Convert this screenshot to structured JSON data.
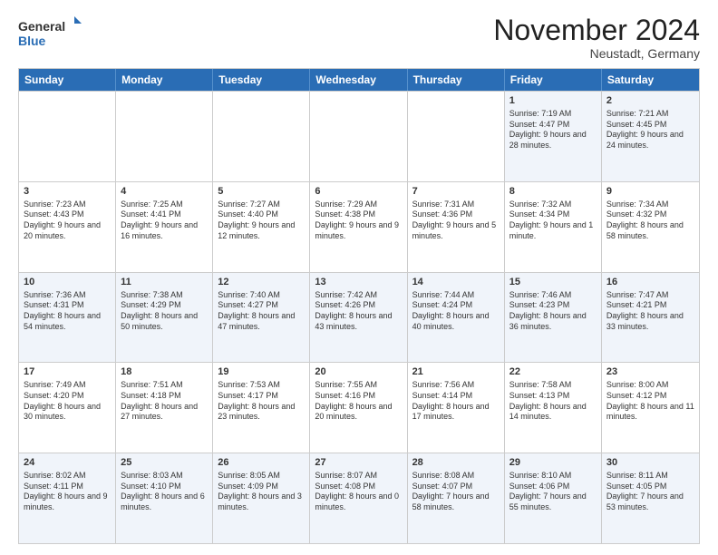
{
  "header": {
    "logo_general": "General",
    "logo_blue": "Blue",
    "month_title": "November 2024",
    "subtitle": "Neustadt, Germany"
  },
  "calendar": {
    "weekdays": [
      "Sunday",
      "Monday",
      "Tuesday",
      "Wednesday",
      "Thursday",
      "Friday",
      "Saturday"
    ],
    "rows": [
      [
        {
          "day": "",
          "info": ""
        },
        {
          "day": "",
          "info": ""
        },
        {
          "day": "",
          "info": ""
        },
        {
          "day": "",
          "info": ""
        },
        {
          "day": "",
          "info": ""
        },
        {
          "day": "1",
          "info": "Sunrise: 7:19 AM\nSunset: 4:47 PM\nDaylight: 9 hours and 28 minutes."
        },
        {
          "day": "2",
          "info": "Sunrise: 7:21 AM\nSunset: 4:45 PM\nDaylight: 9 hours and 24 minutes."
        }
      ],
      [
        {
          "day": "3",
          "info": "Sunrise: 7:23 AM\nSunset: 4:43 PM\nDaylight: 9 hours and 20 minutes."
        },
        {
          "day": "4",
          "info": "Sunrise: 7:25 AM\nSunset: 4:41 PM\nDaylight: 9 hours and 16 minutes."
        },
        {
          "day": "5",
          "info": "Sunrise: 7:27 AM\nSunset: 4:40 PM\nDaylight: 9 hours and 12 minutes."
        },
        {
          "day": "6",
          "info": "Sunrise: 7:29 AM\nSunset: 4:38 PM\nDaylight: 9 hours and 9 minutes."
        },
        {
          "day": "7",
          "info": "Sunrise: 7:31 AM\nSunset: 4:36 PM\nDaylight: 9 hours and 5 minutes."
        },
        {
          "day": "8",
          "info": "Sunrise: 7:32 AM\nSunset: 4:34 PM\nDaylight: 9 hours and 1 minute."
        },
        {
          "day": "9",
          "info": "Sunrise: 7:34 AM\nSunset: 4:32 PM\nDaylight: 8 hours and 58 minutes."
        }
      ],
      [
        {
          "day": "10",
          "info": "Sunrise: 7:36 AM\nSunset: 4:31 PM\nDaylight: 8 hours and 54 minutes."
        },
        {
          "day": "11",
          "info": "Sunrise: 7:38 AM\nSunset: 4:29 PM\nDaylight: 8 hours and 50 minutes."
        },
        {
          "day": "12",
          "info": "Sunrise: 7:40 AM\nSunset: 4:27 PM\nDaylight: 8 hours and 47 minutes."
        },
        {
          "day": "13",
          "info": "Sunrise: 7:42 AM\nSunset: 4:26 PM\nDaylight: 8 hours and 43 minutes."
        },
        {
          "day": "14",
          "info": "Sunrise: 7:44 AM\nSunset: 4:24 PM\nDaylight: 8 hours and 40 minutes."
        },
        {
          "day": "15",
          "info": "Sunrise: 7:46 AM\nSunset: 4:23 PM\nDaylight: 8 hours and 36 minutes."
        },
        {
          "day": "16",
          "info": "Sunrise: 7:47 AM\nSunset: 4:21 PM\nDaylight: 8 hours and 33 minutes."
        }
      ],
      [
        {
          "day": "17",
          "info": "Sunrise: 7:49 AM\nSunset: 4:20 PM\nDaylight: 8 hours and 30 minutes."
        },
        {
          "day": "18",
          "info": "Sunrise: 7:51 AM\nSunset: 4:18 PM\nDaylight: 8 hours and 27 minutes."
        },
        {
          "day": "19",
          "info": "Sunrise: 7:53 AM\nSunset: 4:17 PM\nDaylight: 8 hours and 23 minutes."
        },
        {
          "day": "20",
          "info": "Sunrise: 7:55 AM\nSunset: 4:16 PM\nDaylight: 8 hours and 20 minutes."
        },
        {
          "day": "21",
          "info": "Sunrise: 7:56 AM\nSunset: 4:14 PM\nDaylight: 8 hours and 17 minutes."
        },
        {
          "day": "22",
          "info": "Sunrise: 7:58 AM\nSunset: 4:13 PM\nDaylight: 8 hours and 14 minutes."
        },
        {
          "day": "23",
          "info": "Sunrise: 8:00 AM\nSunset: 4:12 PM\nDaylight: 8 hours and 11 minutes."
        }
      ],
      [
        {
          "day": "24",
          "info": "Sunrise: 8:02 AM\nSunset: 4:11 PM\nDaylight: 8 hours and 9 minutes."
        },
        {
          "day": "25",
          "info": "Sunrise: 8:03 AM\nSunset: 4:10 PM\nDaylight: 8 hours and 6 minutes."
        },
        {
          "day": "26",
          "info": "Sunrise: 8:05 AM\nSunset: 4:09 PM\nDaylight: 8 hours and 3 minutes."
        },
        {
          "day": "27",
          "info": "Sunrise: 8:07 AM\nSunset: 4:08 PM\nDaylight: 8 hours and 0 minutes."
        },
        {
          "day": "28",
          "info": "Sunrise: 8:08 AM\nSunset: 4:07 PM\nDaylight: 7 hours and 58 minutes."
        },
        {
          "day": "29",
          "info": "Sunrise: 8:10 AM\nSunset: 4:06 PM\nDaylight: 7 hours and 55 minutes."
        },
        {
          "day": "30",
          "info": "Sunrise: 8:11 AM\nSunset: 4:05 PM\nDaylight: 7 hours and 53 minutes."
        }
      ]
    ]
  }
}
